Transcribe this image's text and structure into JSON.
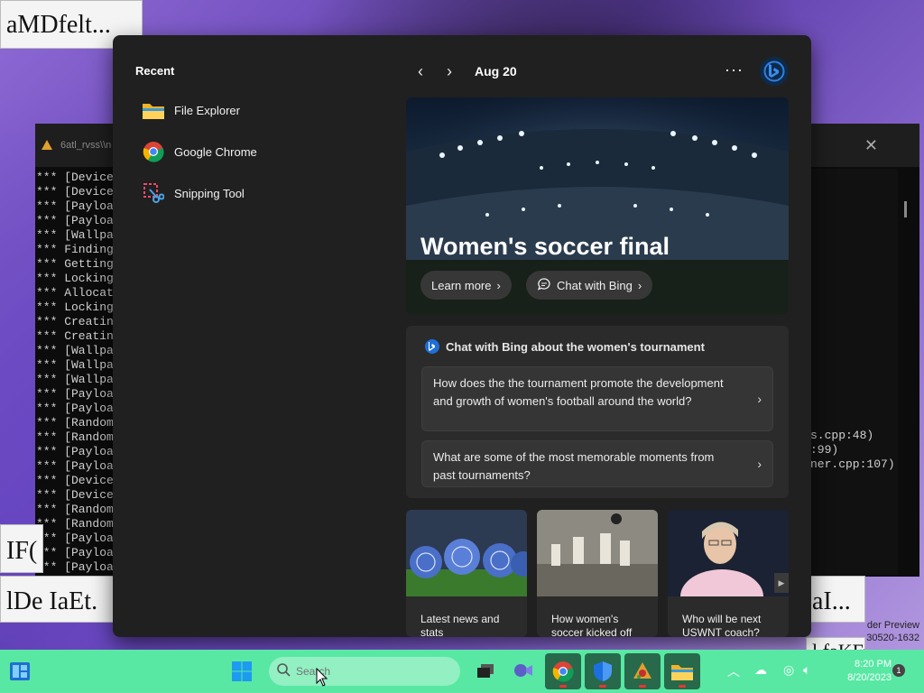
{
  "background": {
    "label_top_left": "aMDfelt...",
    "label_left_mid": "IF(",
    "label_left_bottom": "lDe IaEt.",
    "label_right_bottom": "aI...",
    "label_right_bottom2": "l faKFta",
    "console_title": "6atl_rvss\\\\n",
    "console_lines": [
      "*** [Device",
      "*** [Device",
      "*** [Payloa",
      "*** [Payloa",
      "*** [Wallpa",
      "*** Finding",
      "*** Getting",
      "*** Locking",
      "*** Allocat",
      "*** Locking",
      "*** Creatin",
      "*** Creatin",
      "*** [Wallpa",
      "*** [Wallpa",
      "*** [Wallpa",
      "*** [Payloa",
      "*** [Payloa",
      "*** [Random",
      "*** [Random",
      "*** [Payloa",
      "*** [Payloa",
      "*** [Device",
      "*** [Device",
      "*** [Random",
      "*** [Random",
      "*** [Payloa",
      "*** [Payloa",
      "*** [Payloa"
    ],
    "console_trace": "s.cpp:48)\n:99)\nner.cpp:107)",
    "watermark_line1": "der Preview",
    "watermark_line2": "30520-1632"
  },
  "panel": {
    "recent_title": "Recent",
    "recent_items": [
      {
        "label": "File Explorer",
        "icon": "folder-icon"
      },
      {
        "label": "Google Chrome",
        "icon": "chrome-icon"
      },
      {
        "label": "Snipping Tool",
        "icon": "snipping-tool-icon"
      }
    ],
    "feed": {
      "date": "Aug 20",
      "hero_title": "Women's soccer final",
      "learn_more": "Learn more",
      "chat_with_bing": "Chat with Bing",
      "chat_heading": "Chat with Bing about the women's tournament",
      "suggestions": [
        "How does the the tournament promote the development and growth of women's football around the world?",
        "What are some of the most memorable moments from past tournaments?"
      ],
      "news": [
        "Latest news and stats",
        "How women's soccer kicked off",
        "Who will be next USWNT coach?"
      ]
    }
  },
  "taskbar": {
    "search_placeholder": "Search",
    "time": "8:20 PM",
    "date": "8/20/2023",
    "notification_count": "1",
    "accent": "#58e8a4"
  }
}
